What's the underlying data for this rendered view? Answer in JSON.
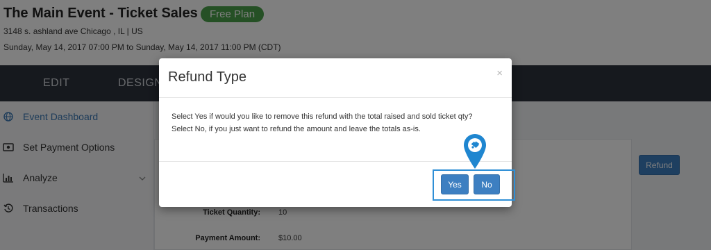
{
  "header": {
    "title": "The Main Event - Ticket Sales",
    "plan_badge": "Free Plan",
    "address": "3148 s. ashland ave Chicago , IL | US",
    "date_range": "Sunday, May 14, 2017 07:00 PM to Sunday, May 14, 2017 11:00 PM (CDT)"
  },
  "navbar": {
    "items": [
      {
        "label": "EDIT"
      },
      {
        "label": "DESIGN"
      }
    ]
  },
  "sidebar": {
    "items": [
      {
        "label": "Event Dashboard",
        "icon": "globe-icon",
        "active": true
      },
      {
        "label": "Set Payment Options",
        "icon": "money-icon"
      },
      {
        "label": "Analyze",
        "icon": "bar-chart-icon",
        "has_submenu": true
      },
      {
        "label": "Transactions",
        "icon": "history-icon"
      }
    ]
  },
  "details": {
    "ticket_quantity_label": "Ticket Quantity:",
    "ticket_quantity_value": "10",
    "payment_amount_label": "Payment Amount:",
    "payment_amount_value": "$10.00"
  },
  "refund_button": {
    "label": "Refund"
  },
  "modal": {
    "title": "Refund Type",
    "close_symbol": "×",
    "line1": "Select Yes if would you like to remove this refund with the total raised and sold ticket qty?",
    "line2": "Select No, if you just want to refund the amount and leave the totals as-is.",
    "yes_label": "Yes",
    "no_label": "No"
  },
  "colors": {
    "accent": "#3d7fc1",
    "navbar": "#2c333d",
    "badge": "#4aa04a",
    "highlight": "#2f8fd6"
  }
}
